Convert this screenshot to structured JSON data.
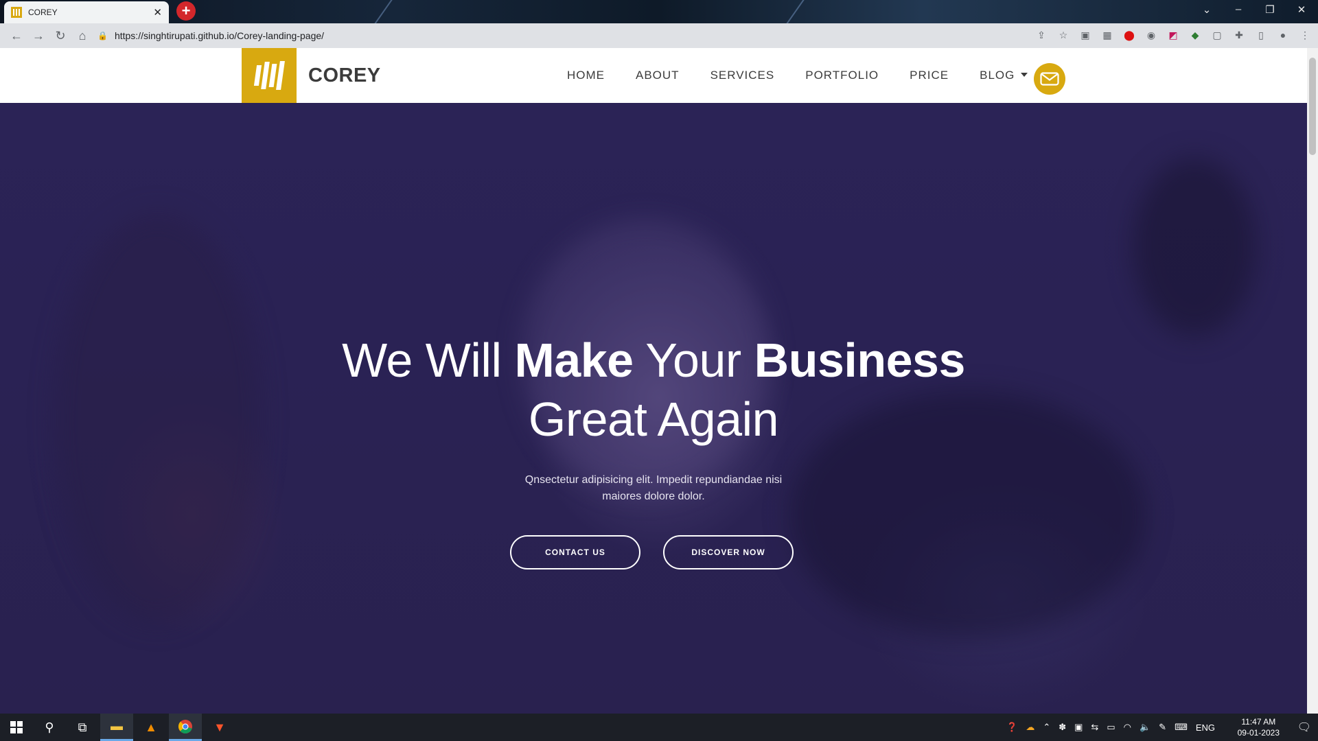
{
  "browser": {
    "tab_title": "COREY",
    "url": "https://singhtirupati.github.io/Corey-landing-page/",
    "new_tab_icon": "plus-icon",
    "window_controls": [
      "chevron-down-icon",
      "minimize-icon",
      "restore-icon",
      "close-icon"
    ]
  },
  "site": {
    "brand": "COREY",
    "nav": [
      {
        "label": "HOME"
      },
      {
        "label": "ABOUT"
      },
      {
        "label": "SERVICES"
      },
      {
        "label": "PORTFOLIO"
      },
      {
        "label": "PRICE"
      },
      {
        "label": "BLOG",
        "has_dropdown": true
      }
    ],
    "contact_icon": "mail-icon"
  },
  "hero": {
    "title_parts": [
      {
        "text": "We Will ",
        "bold": false
      },
      {
        "text": "Make",
        "bold": true
      },
      {
        "text": " Your ",
        "bold": false
      },
      {
        "text": "Business",
        "bold": true
      }
    ],
    "title_line2": "Great Again",
    "subtitle": "Qnsectetur adipisicing elit. Impedit repundiandae nisi maiores dolore dolor.",
    "buttons": [
      {
        "label": "CONTACT US"
      },
      {
        "label": "DISCOVER NOW"
      }
    ]
  },
  "taskbar": {
    "language": "ENG",
    "time": "11:47 AM",
    "date": "09-01-2023"
  },
  "colors": {
    "accent": "#d8a910",
    "hero_overlay": "#2a2254",
    "header_text": "#3b3b3b"
  }
}
